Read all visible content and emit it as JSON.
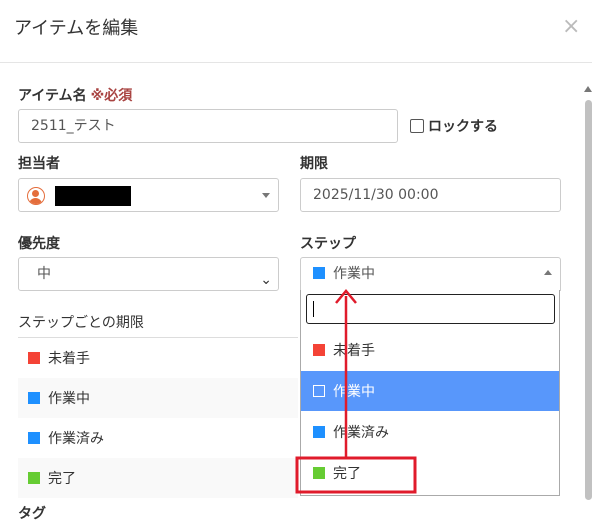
{
  "header": {
    "title": "アイテムを編集",
    "close": "×"
  },
  "item_name": {
    "label": "アイテム名",
    "required": "※必須",
    "value": "2511_テスト"
  },
  "lock": {
    "label": "ロックする"
  },
  "assignee": {
    "label": "担当者"
  },
  "deadline": {
    "label": "期限",
    "value": "2025/11/30 00:00"
  },
  "priority": {
    "label": "優先度",
    "value": "中"
  },
  "step": {
    "label": "ステップ",
    "value": "作業中",
    "color": "#1e90ff"
  },
  "step_deadlines": {
    "label": "ステップごとの期限",
    "rows": [
      {
        "name": "未着手",
        "color": "#f44336"
      },
      {
        "name": "作業中",
        "color": "#1e90ff"
      },
      {
        "name": "作業済み",
        "color": "#1e90ff"
      },
      {
        "name": "完了",
        "color": "#66cc33"
      }
    ]
  },
  "step_dropdown": {
    "search_value": "",
    "options": [
      {
        "name": "未着手",
        "color": "#f44336"
      },
      {
        "name": "作業中",
        "color": "#1e90ff",
        "highlighted": true
      },
      {
        "name": "作業済み",
        "color": "#1e90ff"
      },
      {
        "name": "完了",
        "color": "#66cc33"
      }
    ]
  },
  "tags": {
    "label": "タグ"
  },
  "annotation": {
    "color": "#e01b2b"
  }
}
